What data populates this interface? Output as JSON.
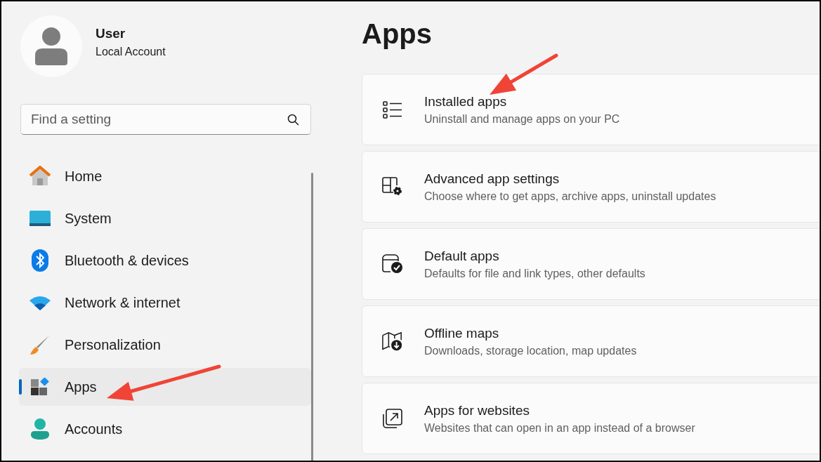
{
  "account": {
    "name": "User",
    "type": "Local Account"
  },
  "search": {
    "placeholder": "Find a setting"
  },
  "nav": [
    {
      "kind": "home",
      "label": "Home",
      "selected": false
    },
    {
      "kind": "system",
      "label": "System",
      "selected": false
    },
    {
      "kind": "bluetooth",
      "label": "Bluetooth & devices",
      "selected": false
    },
    {
      "kind": "network",
      "label": "Network & internet",
      "selected": false
    },
    {
      "kind": "personalization",
      "label": "Personalization",
      "selected": false
    },
    {
      "kind": "apps",
      "label": "Apps",
      "selected": true
    },
    {
      "kind": "accounts",
      "label": "Accounts",
      "selected": false
    }
  ],
  "page_title": "Apps",
  "cards": [
    {
      "kind": "list",
      "title": "Installed apps",
      "subtitle": "Uninstall and manage apps on your PC"
    },
    {
      "kind": "advanced",
      "title": "Advanced app settings",
      "subtitle": "Choose where to get apps, archive apps, uninstall updates"
    },
    {
      "kind": "default",
      "title": "Default apps",
      "subtitle": "Defaults for file and link types, other defaults"
    },
    {
      "kind": "maps",
      "title": "Offline maps",
      "subtitle": "Downloads, storage location, map updates"
    },
    {
      "kind": "websites",
      "title": "Apps for websites",
      "subtitle": "Websites that can open in an app instead of a browser"
    }
  ],
  "annotations": [
    {
      "kind": "arrow"
    },
    {
      "kind": "arrow"
    }
  ]
}
